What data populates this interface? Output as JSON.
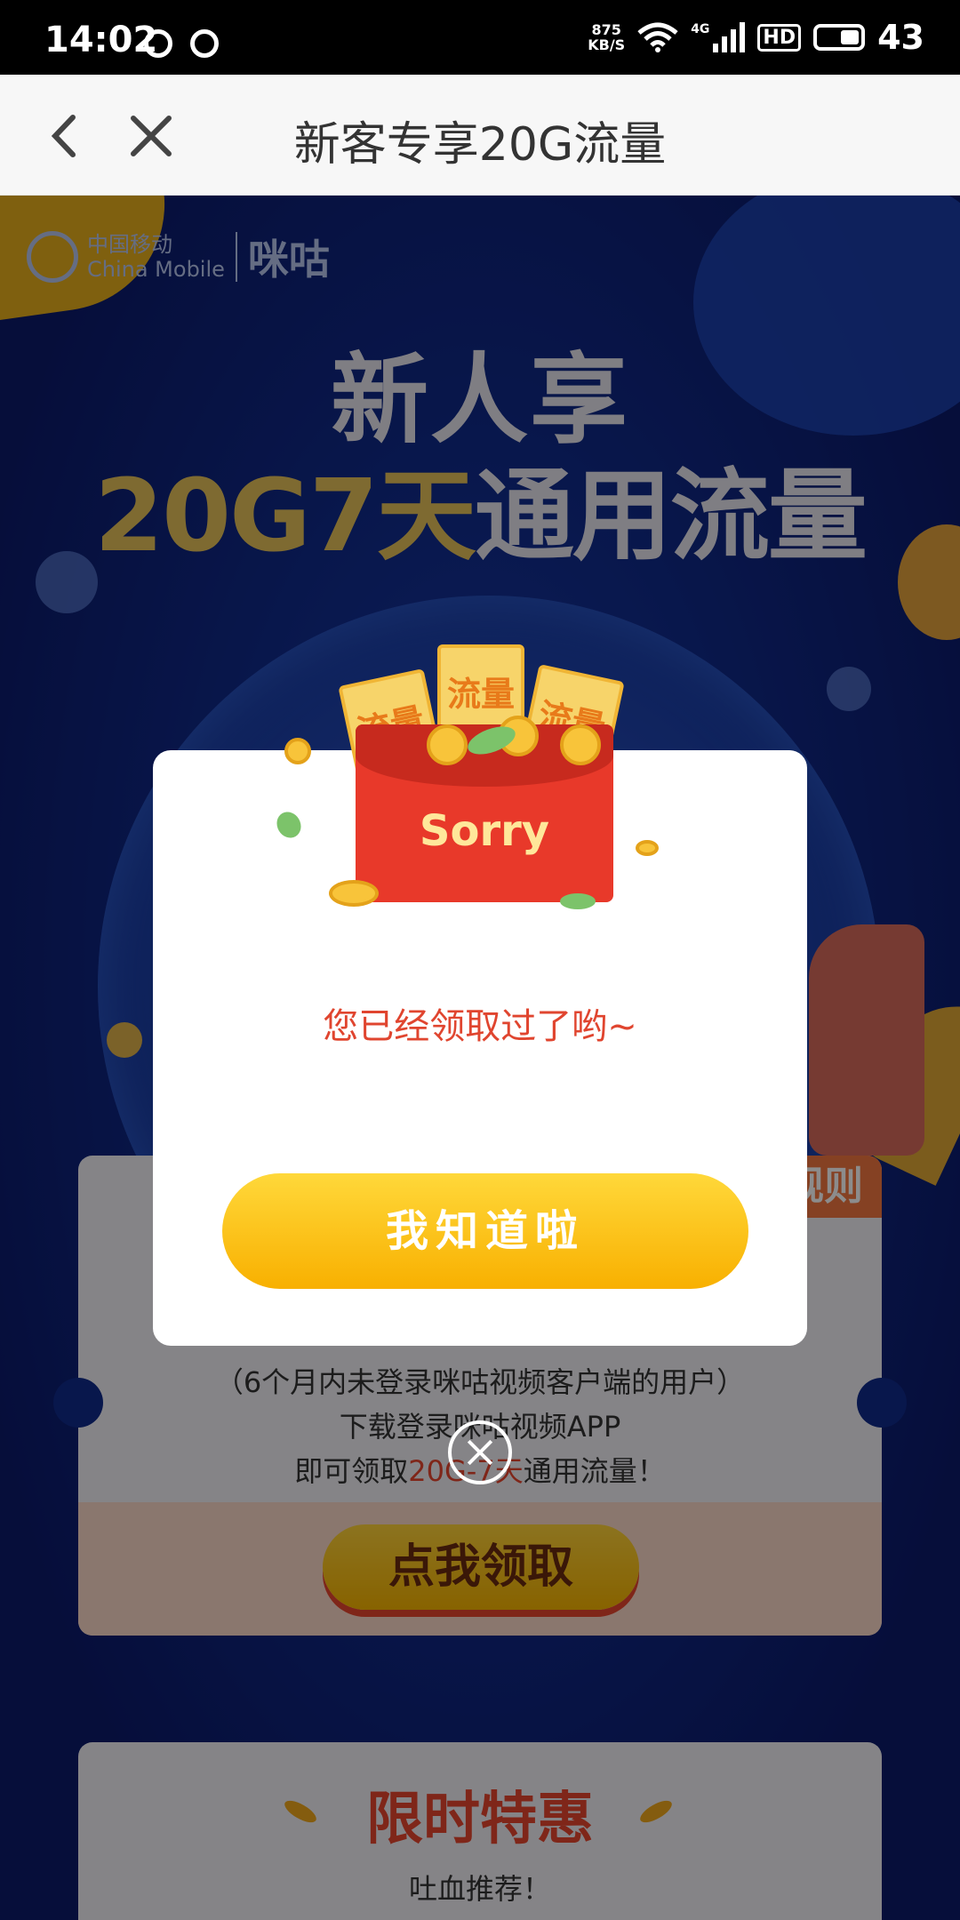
{
  "status_bar": {
    "time": "14:02",
    "speed_value": "875",
    "speed_unit": "KB/S",
    "network": "4G",
    "hd": "HD",
    "battery": "43"
  },
  "app_bar": {
    "title": "新客专享20G流量",
    "back_icon": "chevron-left",
    "close_icon": "close"
  },
  "logo": {
    "cn": "中国移动",
    "en": "China Mobile",
    "brand": "咪咕"
  },
  "hero": {
    "line1": "新人享",
    "line2_yellow": "20G7天",
    "line2_white": "通用流量"
  },
  "card": {
    "rule_tag": "规则",
    "line1": "（6个月内未登录咪咕视频客户端的用户）",
    "line2": "下载登录咪咕视频APP",
    "line3_a": "即可领取",
    "line3_red": "20G-7天",
    "line3_b": "通用流量！",
    "claim_button": "点我领取"
  },
  "promo": {
    "title": "限时特惠",
    "subtitle": "吐血推荐！"
  },
  "modal": {
    "envelope_text": "Sorry",
    "ticket_text": "流量",
    "message": "您已经领取过了哟~",
    "button": "我知道啦"
  },
  "colors": {
    "accent_yellow": "#f8b000",
    "alert_red": "#e0452f",
    "page_blue": "#102a8a"
  }
}
